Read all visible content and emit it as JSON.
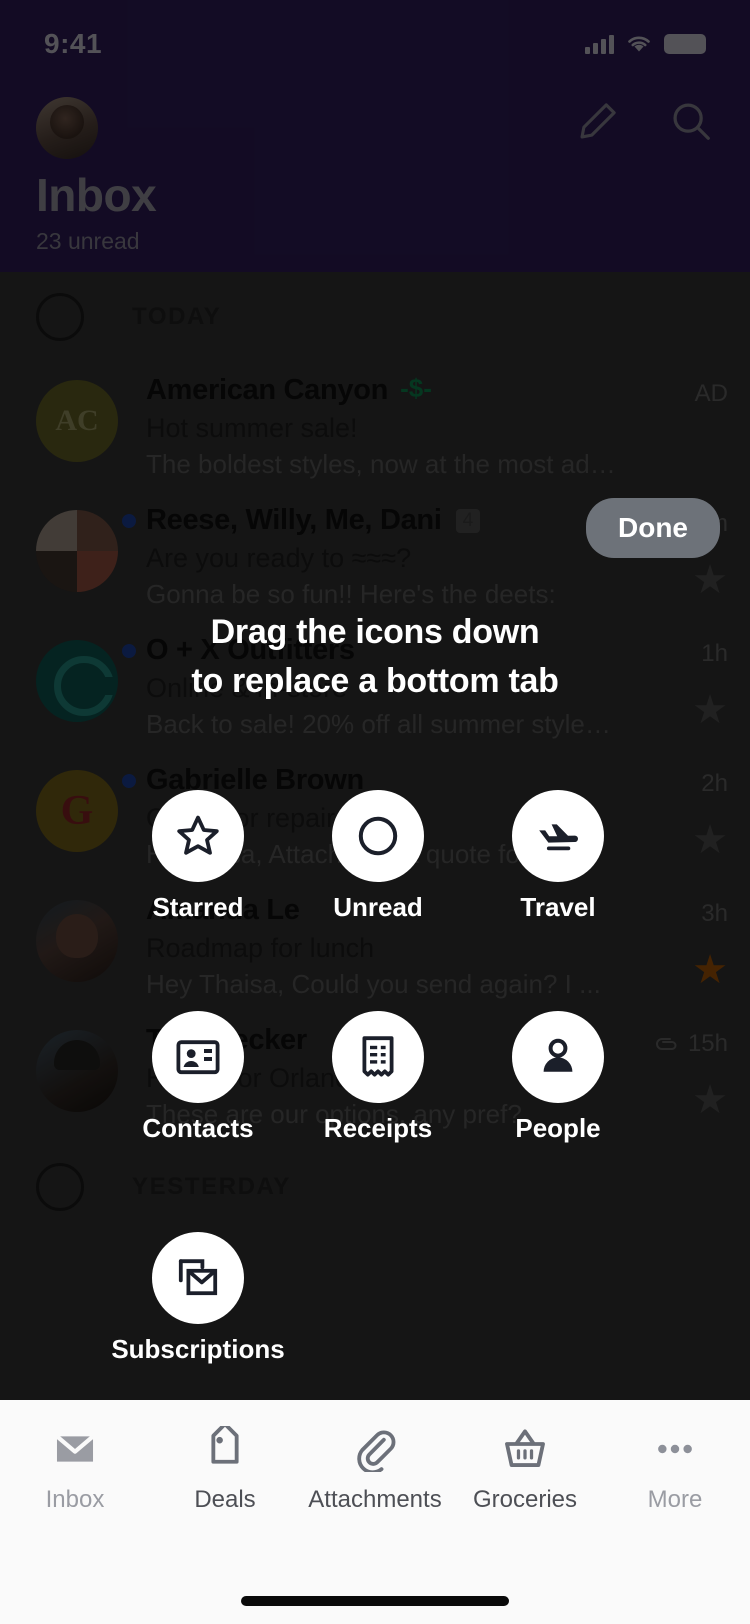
{
  "status_bar": {
    "time": "9:41",
    "signal_icon": "cellular-signal-icon",
    "wifi_icon": "wifi-icon",
    "battery_icon": "battery-icon"
  },
  "header": {
    "avatar": "user-avatar",
    "compose_icon": "compose-pencil-icon",
    "search_icon": "search-icon",
    "title": "Inbox",
    "subtitle": "23 unread"
  },
  "list": {
    "sections": [
      {
        "label": "TODAY",
        "rows": [
          {
            "avatar_initials": "AC",
            "sender": "American Canyon",
            "sparkle": "-$-",
            "subject": "Hot summer sale!",
            "preview": "The boldest styles, now at the most adven...",
            "meta": "AD",
            "unread": false,
            "starred": false,
            "count": ""
          },
          {
            "avatar_initials": "",
            "sender": "Reese, Willy, Me, Dani",
            "count": "4",
            "subject": "Are you ready to ≈≈≈?",
            "preview": "Gonna be so fun!! Here's the deets:",
            "meta": "10m",
            "unread": true,
            "starred": false
          },
          {
            "avatar_initials": "",
            "sender": "O + X Outfitters",
            "count": "",
            "subject": "Online & in-store",
            "preview": "Back to sale! 20% off all summer styles...",
            "meta": "1h",
            "unread": true,
            "starred": false
          },
          {
            "avatar_initials": "G",
            "sender": "Gabrielle Brown",
            "count": "",
            "subject": "Quote for repairs",
            "preview": "Hi Thaisa, Attached is a quote for all ...",
            "meta": "2h",
            "unread": true,
            "starred": false
          },
          {
            "avatar_initials": "",
            "sender": "Amanda Le",
            "count": "",
            "subject": "Roadmap for lunch",
            "preview": "Hey Thaisa, Could you send again? I ...",
            "meta": "3h",
            "unread": false,
            "starred": true
          },
          {
            "avatar_initials": "",
            "sender": "Tom Becker",
            "count": "",
            "subject": "Hotels for Orlando Trip",
            "preview": "These are our options, any pref?",
            "meta": "15h",
            "attachment_icon": "paperclip-icon",
            "unread": false,
            "starred": false
          }
        ]
      },
      {
        "label": "YESTERDAY",
        "rows": []
      }
    ]
  },
  "overlay": {
    "done_label": "Done",
    "hint_line1": "Drag the icons down",
    "hint_line2": "to replace a bottom tab",
    "shortcuts": [
      {
        "label": "Starred",
        "icon": "star-outline-icon"
      },
      {
        "label": "Unread",
        "icon": "circle-outline-icon"
      },
      {
        "label": "Travel",
        "icon": "airplane-icon"
      },
      {
        "label": "Contacts",
        "icon": "contact-card-icon"
      },
      {
        "label": "Receipts",
        "icon": "receipt-icon"
      },
      {
        "label": "People",
        "icon": "person-icon"
      },
      {
        "label": "Subscriptions",
        "icon": "subscriptions-envelope-icon"
      }
    ]
  },
  "tabbar": {
    "tabs": [
      {
        "label": "Inbox",
        "icon": "envelope-icon",
        "active": false
      },
      {
        "label": "Deals",
        "icon": "tag-icon",
        "active": true
      },
      {
        "label": "Attachments",
        "icon": "paperclip-icon",
        "active": true
      },
      {
        "label": "Groceries",
        "icon": "basket-icon",
        "active": true
      },
      {
        "label": "More",
        "icon": "ellipsis-icon",
        "active": false
      }
    ]
  },
  "colors": {
    "header_bg": "#2a1a51",
    "overlay_scrim": "rgba(0,0,0,0.58)",
    "star_on": "#9a4f06",
    "unread_dot": "#1a3a8f",
    "done_bg": "#6d7279",
    "sparkle_green": "#0d7a47"
  }
}
